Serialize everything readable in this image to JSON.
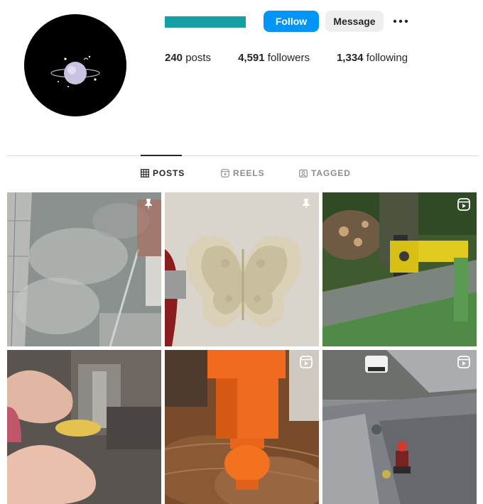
{
  "profile": {
    "avatar_icon": "planet-avatar-icon",
    "username_color": "#15a0a4"
  },
  "actions": {
    "follow_label": "Follow",
    "message_label": "Message",
    "more_icon": "more-options-icon",
    "follow_color": "#0095f6"
  },
  "stats": {
    "posts_count": "240",
    "posts_label": "posts",
    "followers_count": "4,591",
    "followers_label": "followers",
    "following_count": "1,334",
    "following_label": "following"
  },
  "tabs": [
    {
      "label": "POSTS",
      "icon": "grid-icon",
      "active": true
    },
    {
      "label": "REELS",
      "icon": "reels-icon",
      "active": false
    },
    {
      "label": "TAGGED",
      "icon": "tagged-icon",
      "active": false
    }
  ],
  "posts": [
    {
      "name": "post-1",
      "content": "floor cleaning with foam",
      "badge": "pin-icon"
    },
    {
      "name": "post-2",
      "content": "butterfly silicone mold",
      "badge": "pin-icon"
    },
    {
      "name": "post-3",
      "content": "yellow machine cutting timber",
      "badge": "reel-icon"
    },
    {
      "name": "post-4",
      "content": "hands holding leaf cutout at machine",
      "badge": "none"
    },
    {
      "name": "post-5",
      "content": "orange furniture leg",
      "badge": "reel-icon"
    },
    {
      "name": "post-6",
      "content": "worker on street with car",
      "badge": "reel-icon"
    }
  ]
}
